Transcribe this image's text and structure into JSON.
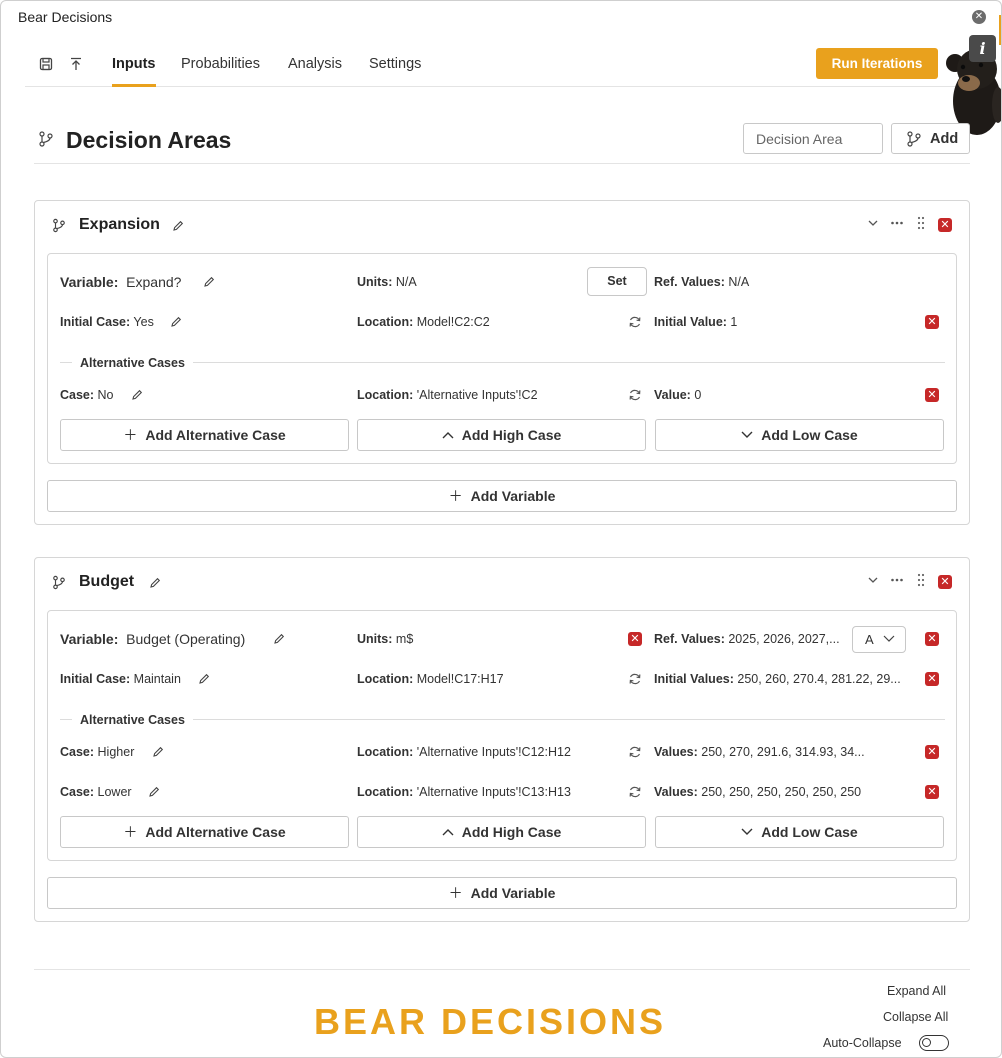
{
  "app": {
    "title": "Bear Decisions",
    "close_glyph": "✕"
  },
  "toolbar": {
    "tabs": [
      {
        "label": "Inputs",
        "active": true
      },
      {
        "label": "Probabilities",
        "active": false
      },
      {
        "label": "Analysis",
        "active": false
      },
      {
        "label": "Settings",
        "active": false
      }
    ],
    "run_label": "Run Iterations",
    "info_glyph": "i",
    "icons": [
      "save-icon",
      "export-icon"
    ]
  },
  "decision_areas": {
    "title": "Decision Areas",
    "input_placeholder": "Decision Area",
    "add_label": "Add"
  },
  "areas": [
    {
      "name": "Expansion",
      "variables": [
        {
          "variable_label": "Variable:",
          "variable_name": "Expand?",
          "units_label": "Units:",
          "units_value": "N/A",
          "set_label": "Set",
          "ref_label": "Ref. Values:",
          "ref_value": "N/A",
          "initial_label": "Initial Case:",
          "initial_value": "Yes",
          "location_label": "Location:",
          "location_value": "Model!C2:C2",
          "init_value_label": "Initial Value:",
          "init_value_value": "1",
          "alt_title": "Alternative Cases",
          "cases": [
            {
              "case_label": "Case:",
              "case_value": "No",
              "location_label": "Location:",
              "location_value": "'Alternative Inputs'!C2",
              "value_label": "Value:",
              "value_value": "0"
            }
          ],
          "buttons": {
            "alt": "Add Alternative Case",
            "high": "Add High Case",
            "low": "Add Low Case"
          }
        }
      ],
      "add_variable_label": "Add Variable"
    },
    {
      "name": "Budget",
      "variables": [
        {
          "variable_label": "Variable:",
          "variable_name": "Budget (Operating)",
          "units_label": "Units:",
          "units_value": "m$",
          "ref_label": "Ref. Values:",
          "ref_value": "2025, 2026, 2027,...",
          "select_value": "A",
          "initial_label": "Initial Case:",
          "initial_value": "Maintain",
          "location_label": "Location:",
          "location_value": "Model!C17:H17",
          "init_value_label": "Initial Values:",
          "init_value_value": "250, 260, 270.4, 281.22, 29...",
          "alt_title": "Alternative Cases",
          "cases": [
            {
              "case_label": "Case:",
              "case_value": "Higher",
              "location_label": "Location:",
              "location_value": "'Alternative Inputs'!C12:H12",
              "value_label": "Values:",
              "value_value": "250, 270, 291.6, 314.93, 34..."
            },
            {
              "case_label": "Case:",
              "case_value": "Lower",
              "location_label": "Location:",
              "location_value": "'Alternative Inputs'!C13:H13",
              "value_label": "Values:",
              "value_value": "250, 250, 250, 250, 250, 250"
            }
          ],
          "buttons": {
            "alt": "Add Alternative Case",
            "high": "Add High Case",
            "low": "Add Low Case"
          }
        }
      ],
      "add_variable_label": "Add Variable"
    }
  ],
  "footer": {
    "logo_text": "BEAR DECISIONS",
    "expand_all": "Expand All",
    "collapse_all": "Collapse All",
    "auto_collapse": "Auto-Collapse",
    "auto_collapse_on": false
  },
  "colors": {
    "accent": "#e9a11d",
    "danger": "#c62828",
    "text": "#222222",
    "border": "#d6d6d6"
  }
}
